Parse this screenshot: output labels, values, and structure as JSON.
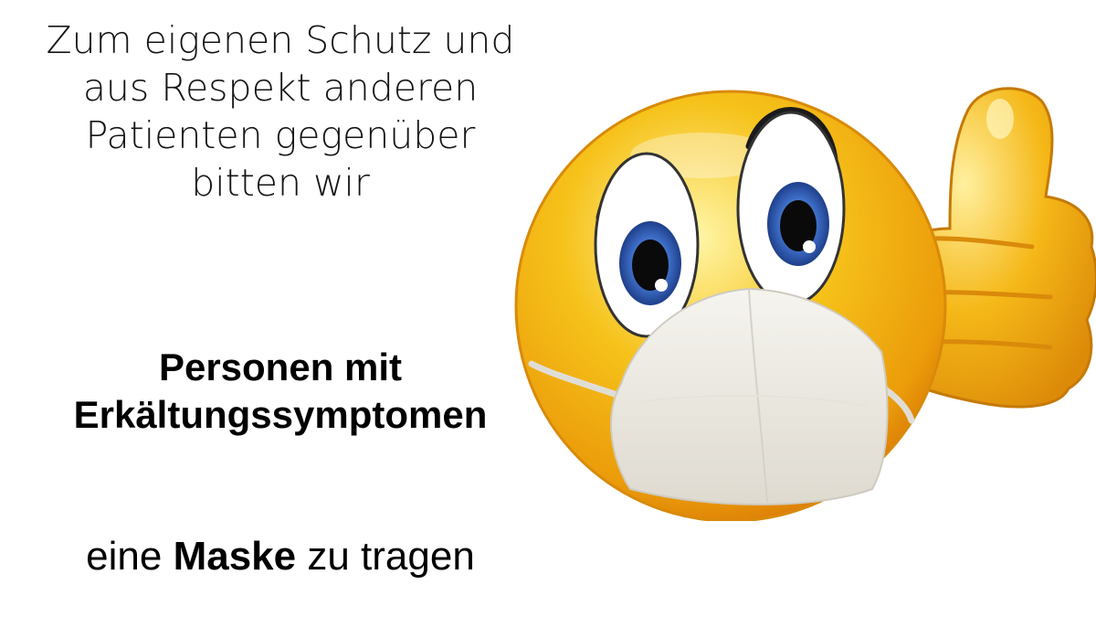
{
  "intro_lines": [
    "Zum eigenen Schutz und",
    "aus Respekt anderen",
    "Patienten gegenüber",
    "bitten wir"
  ],
  "emphasis_lines": [
    "Personen mit",
    "Erkältungssymptomen"
  ],
  "closing": {
    "before": "eine",
    "bold": "Maske",
    "after": "zu tragen"
  },
  "illustration": {
    "icon": "masked-thumbs-up-emoji-icon",
    "colors": {
      "face": "#f6c21a",
      "face_shadow": "#e08a06",
      "iris": "#3e6fc9",
      "mask": "#eeebe4",
      "thumb": "#f5b818"
    }
  }
}
